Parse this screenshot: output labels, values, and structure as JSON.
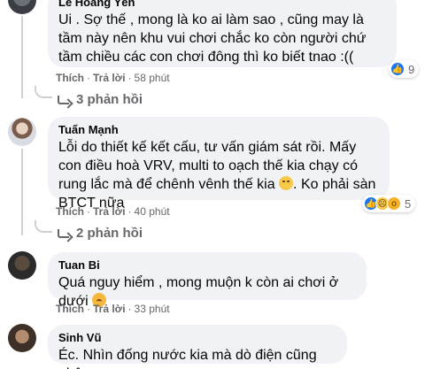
{
  "comments": [
    {
      "author": "Lê Hoàng Yến",
      "text": "Ui . Sợ thế , mong là ko ai làm sao , cũng may là tầm này nên khu vui chơi chắc ko còn người chứ tầm chiều các con chơi đông thì ko biết tnao :((",
      "like": "Thích",
      "reply": "Trả lời",
      "time": "58 phút",
      "reaction_count": "9",
      "reaction_icons": [
        "like-icon"
      ],
      "replies_label": "3 phản hồi"
    },
    {
      "author": "Tuấn Mạnh",
      "text_before_emoji": "Lỗi do thiết kế kết cấu, tư vấn giám sát rồi. Mấy con điều hoà VRV, multi to oạch thế kia chạy có rung lắc mà để chênh vênh thế kia ",
      "text_after_emoji": ". Ko phải sàn BTCT nữa",
      "inline_emoji": "sad-face-emoji",
      "like": "Thích",
      "reply": "Trả lời",
      "time": "40 phút",
      "reaction_count": "5",
      "reaction_icons": [
        "like-icon",
        "sad-icon",
        "wow-icon"
      ],
      "replies_label": "2 phản hồi"
    },
    {
      "author": "Tuan Bi",
      "text": "Quá nguy hiểm , mong muộn k còn ai chơi ở dưới ",
      "inline_emoji": "worried-face-emoji",
      "like": "Thích",
      "reply": "Trả lời",
      "time": "33 phút"
    },
    {
      "author": "Sinh Vũ",
      "text": "Éc. Nhìn đống nước kia mà dò điện cũng ghê."
    }
  ],
  "separator": "·",
  "colors": {
    "bubble": "#f0f2f5",
    "meta": "#65676b",
    "like_blue": "#1877f2",
    "emoji_yellow": "#f7c948"
  }
}
